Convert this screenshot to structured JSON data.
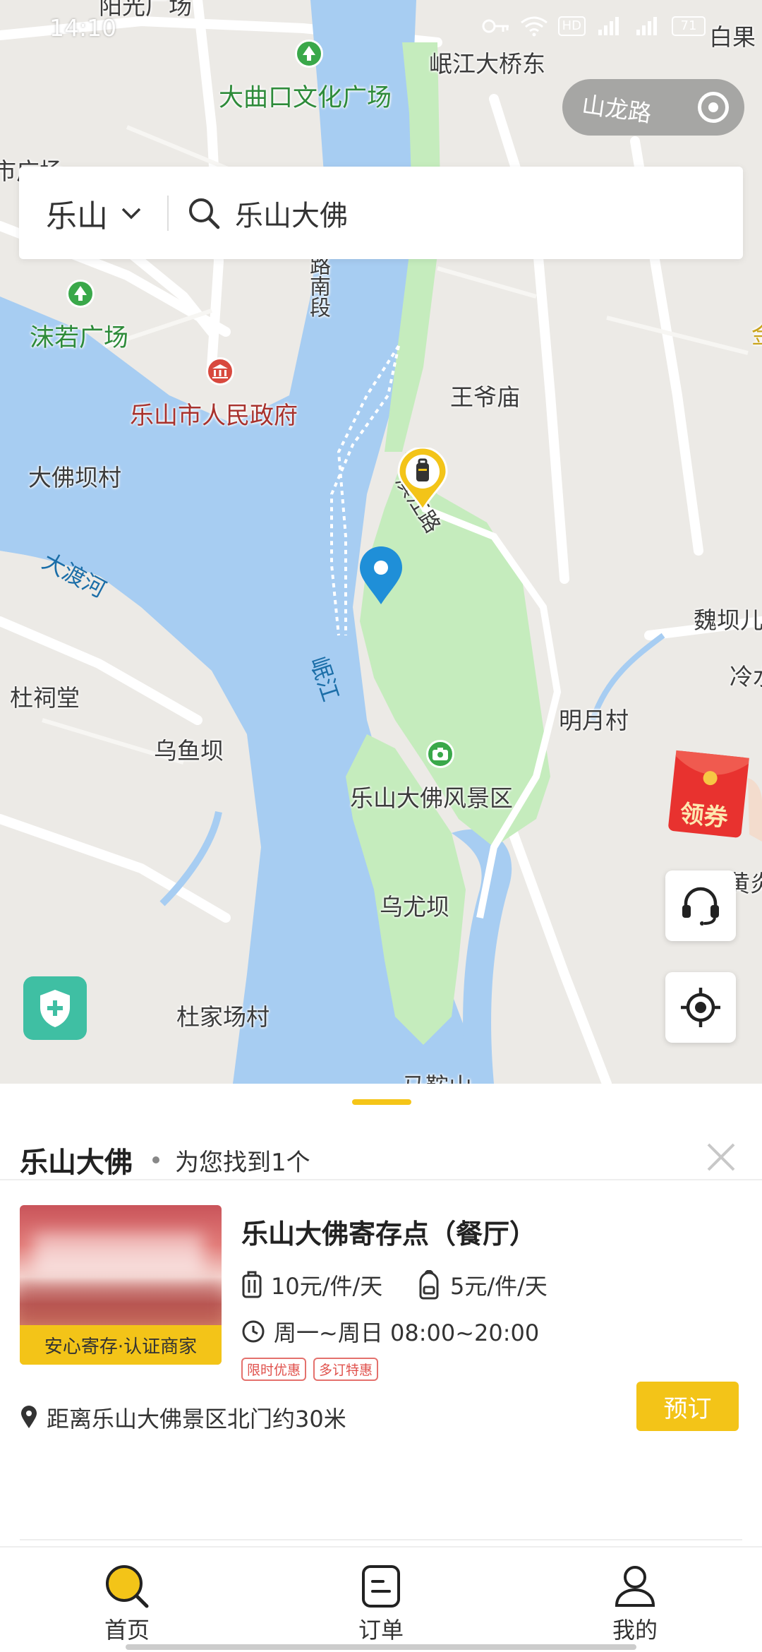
{
  "status_bar": {
    "time": "14:10",
    "icons": [
      "hd-icon",
      "wifi-icon",
      "signal-4g-icon",
      "signal-4g-icon",
      "battery-icon"
    ],
    "hd_label": "HD",
    "battery_label": "71"
  },
  "map": {
    "road_chip_label": "山龙路",
    "labels": {
      "yangguang": "阳光广场",
      "daqukou": "大曲口文化广场",
      "minjiang_bridge": "岷江大桥东",
      "baiguo": "白果",
      "shi_guangchang": "市广场",
      "moruo": "沫若广场",
      "lunan": "路南段",
      "wangyemiao": "王爷庙",
      "gov": "乐山市人民政府",
      "dafoba": "大佛坝村",
      "binjiang": "滨江路",
      "dadu": "大渡河",
      "weiba": "魏坝儿",
      "lengshui": "冷水",
      "minjiang": "岷江",
      "dusitang": "杜祠堂",
      "mingyue": "明月村",
      "wuyuba": "乌鱼坝",
      "scenic": "乐山大佛风景区",
      "huangyan": "黄炎",
      "wuyouba": "乌尤坝",
      "dujiachang": "杜家场村",
      "maanshan": "马鞍山",
      "jin": "金"
    },
    "coupon_label": "领券",
    "colors": {
      "land": "#eceae6",
      "water": "#a7cdf2",
      "park": "#c5ecbd",
      "road": "#ffffff",
      "accent": "#f3c418",
      "pin_blue": "#1f8fd8"
    }
  },
  "search": {
    "city": "乐山",
    "query": "乐山大佛"
  },
  "sheet": {
    "title": "乐山大佛",
    "result_count": "为您找到1个",
    "card": {
      "name": "乐山大佛寄存点（餐厅）",
      "badge": "安心寄存·认证商家",
      "price_large": "10元/件/天",
      "price_small": "5元/件/天",
      "hours": "周一~周日 08:00~20:00",
      "tags": [
        "限时优惠",
        "多订特惠"
      ],
      "distance": "距离乐山大佛景区北门约30米",
      "book_label": "预订"
    }
  },
  "tabbar": {
    "home": "首页",
    "orders": "订单",
    "mine": "我的",
    "active": "home"
  }
}
